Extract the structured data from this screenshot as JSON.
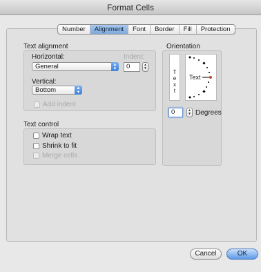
{
  "window": {
    "title": "Format Cells"
  },
  "tabs": [
    {
      "label": "Number"
    },
    {
      "label": "Alignment",
      "selected": true
    },
    {
      "label": "Font"
    },
    {
      "label": "Border"
    },
    {
      "label": "Fill"
    },
    {
      "label": "Protection"
    }
  ],
  "text_alignment": {
    "heading": "Text alignment",
    "horizontal_label": "Horizontal:",
    "horizontal_value": "General",
    "indent_label": "Indent:",
    "indent_value": "0",
    "vertical_label": "Vertical:",
    "vertical_value": "Bottom",
    "add_indent_label": "Add indent"
  },
  "text_control": {
    "heading": "Text control",
    "wrap_text_label": "Wrap text",
    "shrink_to_fit_label": "Shrink to fit",
    "merge_cells_label": "Merge cells"
  },
  "orientation": {
    "heading": "Orientation",
    "vertical_text": [
      "T",
      "e",
      "x",
      "t"
    ],
    "dial_text": "Text",
    "degrees_value": "0",
    "degrees_label": "Degrees"
  },
  "buttons": {
    "cancel": "Cancel",
    "ok": "OK"
  },
  "colors": {
    "accent": "#5c9ae8",
    "dial_handle": "#c0442a"
  }
}
